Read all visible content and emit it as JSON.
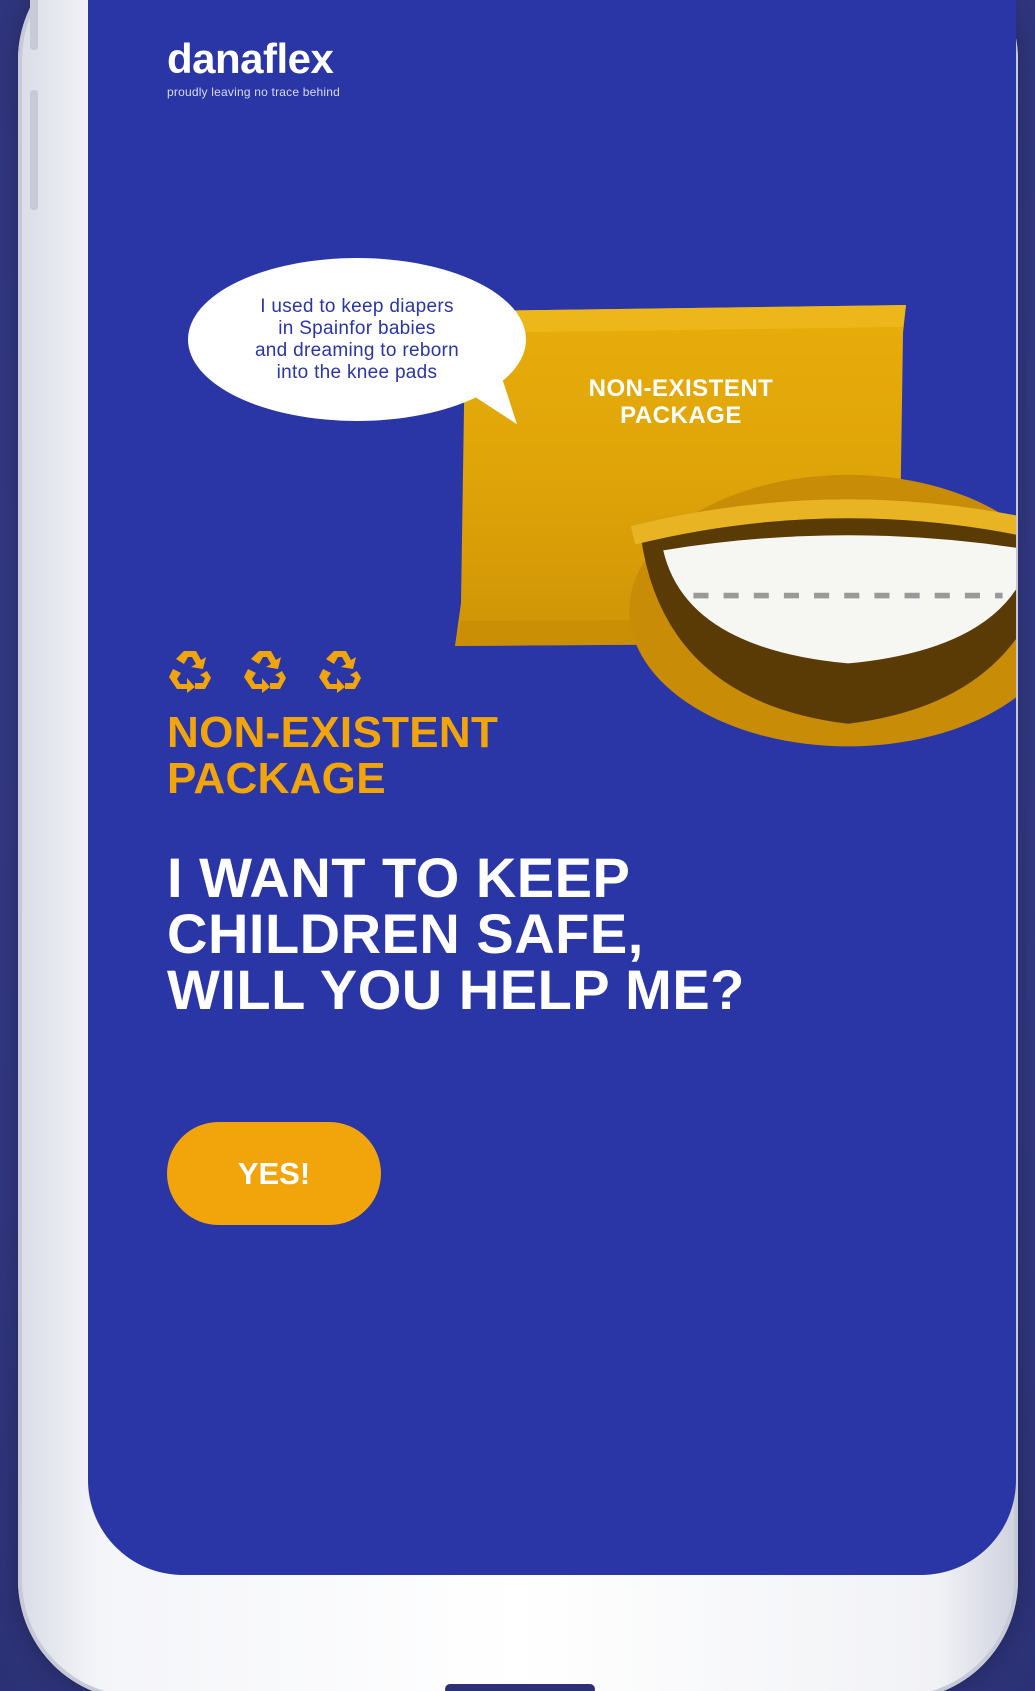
{
  "brand": {
    "name": "danaflex",
    "tagline": "proudly leaving no trace behind"
  },
  "bubble": {
    "lines": [
      "I used to keep diapers",
      "in Spainfor babies",
      "and dreaming to reborn",
      "into the knee pads"
    ]
  },
  "package": {
    "label_line1": "NON-EXISTENT",
    "label_line2": "PACKAGE"
  },
  "product": {
    "title_line1": "NON-EXISTENT",
    "title_line2": "PACKAGE",
    "recycle_icons": [
      "recycle-icon",
      "recycle-icon",
      "recycle-icon"
    ]
  },
  "headline": {
    "line1": "I WANT TO KEEP",
    "line2": "CHILDREN SAFE,",
    "line3": "WILL YOU HELP ME?"
  },
  "cta": {
    "label": "YES!"
  },
  "colors": {
    "screen_bg": "#2a35a6",
    "accent": "#f2a50a",
    "text": "#ffffff"
  }
}
